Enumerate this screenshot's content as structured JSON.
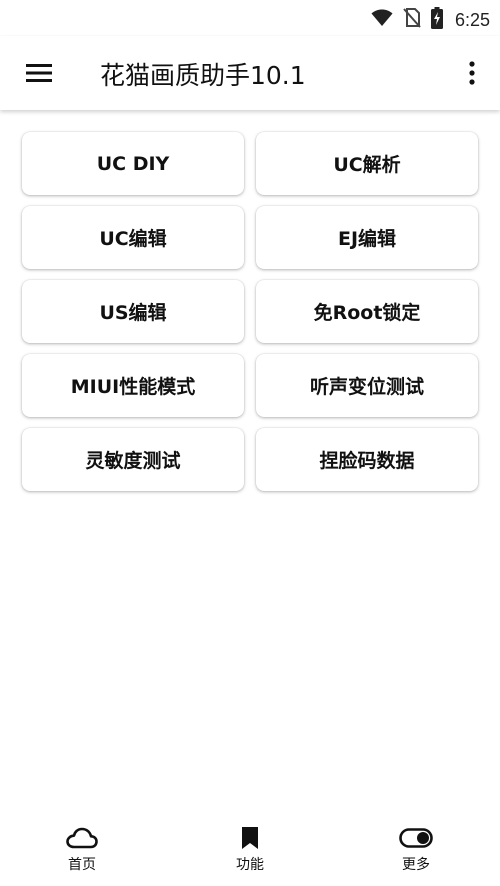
{
  "status_bar": {
    "time": "6:25",
    "icons": [
      "wifi-icon",
      "no-sim-icon",
      "battery-charging-icon"
    ]
  },
  "app_bar": {
    "menu_icon": "hamburger-menu-icon",
    "title": "花猫画质助手10.1",
    "overflow_icon": "more-vertical-icon"
  },
  "buttons": [
    {
      "label": "UC DIY"
    },
    {
      "label": "UC解析"
    },
    {
      "label": "UC编辑"
    },
    {
      "label": "EJ编辑"
    },
    {
      "label": "US编辑"
    },
    {
      "label": "免Root锁定"
    },
    {
      "label": "MIUI性能模式"
    },
    {
      "label": "听声变位测试"
    },
    {
      "label": "灵敏度测试"
    },
    {
      "label": "捏脸码数据"
    }
  ],
  "bottom_nav": [
    {
      "label": "首页",
      "icon": "cloud-icon"
    },
    {
      "label": "功能",
      "icon": "bookmark-icon"
    },
    {
      "label": "更多",
      "icon": "toggle-icon"
    }
  ]
}
